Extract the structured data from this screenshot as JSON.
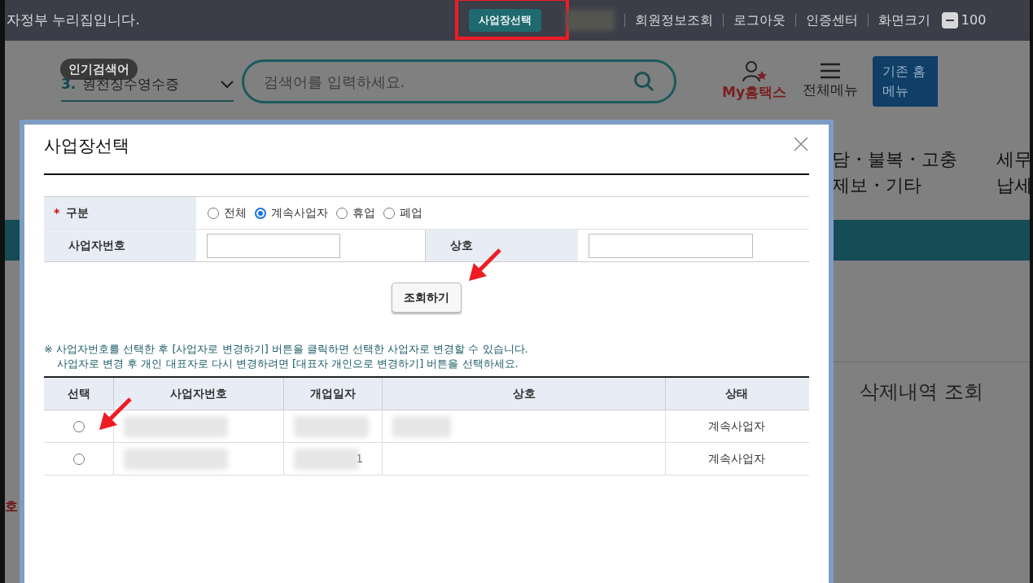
{
  "top_bar": {
    "notice": "자정부 누리집입니다.",
    "business_button": "사업장선택",
    "links": [
      "회원정보조회",
      "로그아웃",
      "인증센터",
      "화면크기"
    ],
    "zoom": "100"
  },
  "header": {
    "popular_badge": "인기검색어",
    "popular_rank": "3.",
    "popular_text": "원천징수영수증",
    "search": {
      "placeholder": "검색어를 입력하세요."
    },
    "my_hometax": "My홈택스",
    "all_menu": "전체메뉴",
    "legacy_button": [
      "기존 홈",
      "메뉴"
    ]
  },
  "background": {
    "nav": [
      {
        "lines": [
          "담・불복・고충",
          "제보・기타"
        ]
      },
      {
        "lines": [
          "세무",
          "납세"
        ]
      }
    ],
    "left_mark": "호",
    "deleted_history": "삭제내역 조회"
  },
  "dialog": {
    "title": "사업장선택",
    "filter": {
      "label": "구분",
      "required_mark": "*",
      "options": [
        {
          "label": "전체",
          "selected": false
        },
        {
          "label": "계속사업자",
          "selected": true
        },
        {
          "label": "휴업",
          "selected": false
        },
        {
          "label": "폐업",
          "selected": false
        }
      ]
    },
    "fields": [
      {
        "label": "사업자번호"
      },
      {
        "label": "상호"
      }
    ],
    "search_button": "조회하기",
    "notes": [
      "※ 사업자번호를 선택한 후 [사업자로 변경하기] 버튼을 클릭하면 선택한 사업자로 변경할 수 있습니다.",
      "사업자로 변경 후 개인 대표자로 다시 변경하려면 [대표자 개인으로 변경하기] 버튼을 선택하세요."
    ],
    "table": {
      "columns": [
        "선택",
        "사업자번호",
        "개업일자",
        "상호",
        "상태"
      ],
      "rows": [
        {
          "selected": false,
          "cells": [
            {
              "redacted": true
            },
            {
              "redacted": true
            },
            {
              "redacted": true
            },
            {
              "text": "계속사업자"
            }
          ]
        },
        {
          "selected": false,
          "cells": [
            {
              "redacted": true
            },
            {
              "redacted": true,
              "text": "1"
            },
            {
              "redacted": false
            },
            {
              "text": "계속사업자"
            }
          ]
        }
      ]
    }
  }
}
